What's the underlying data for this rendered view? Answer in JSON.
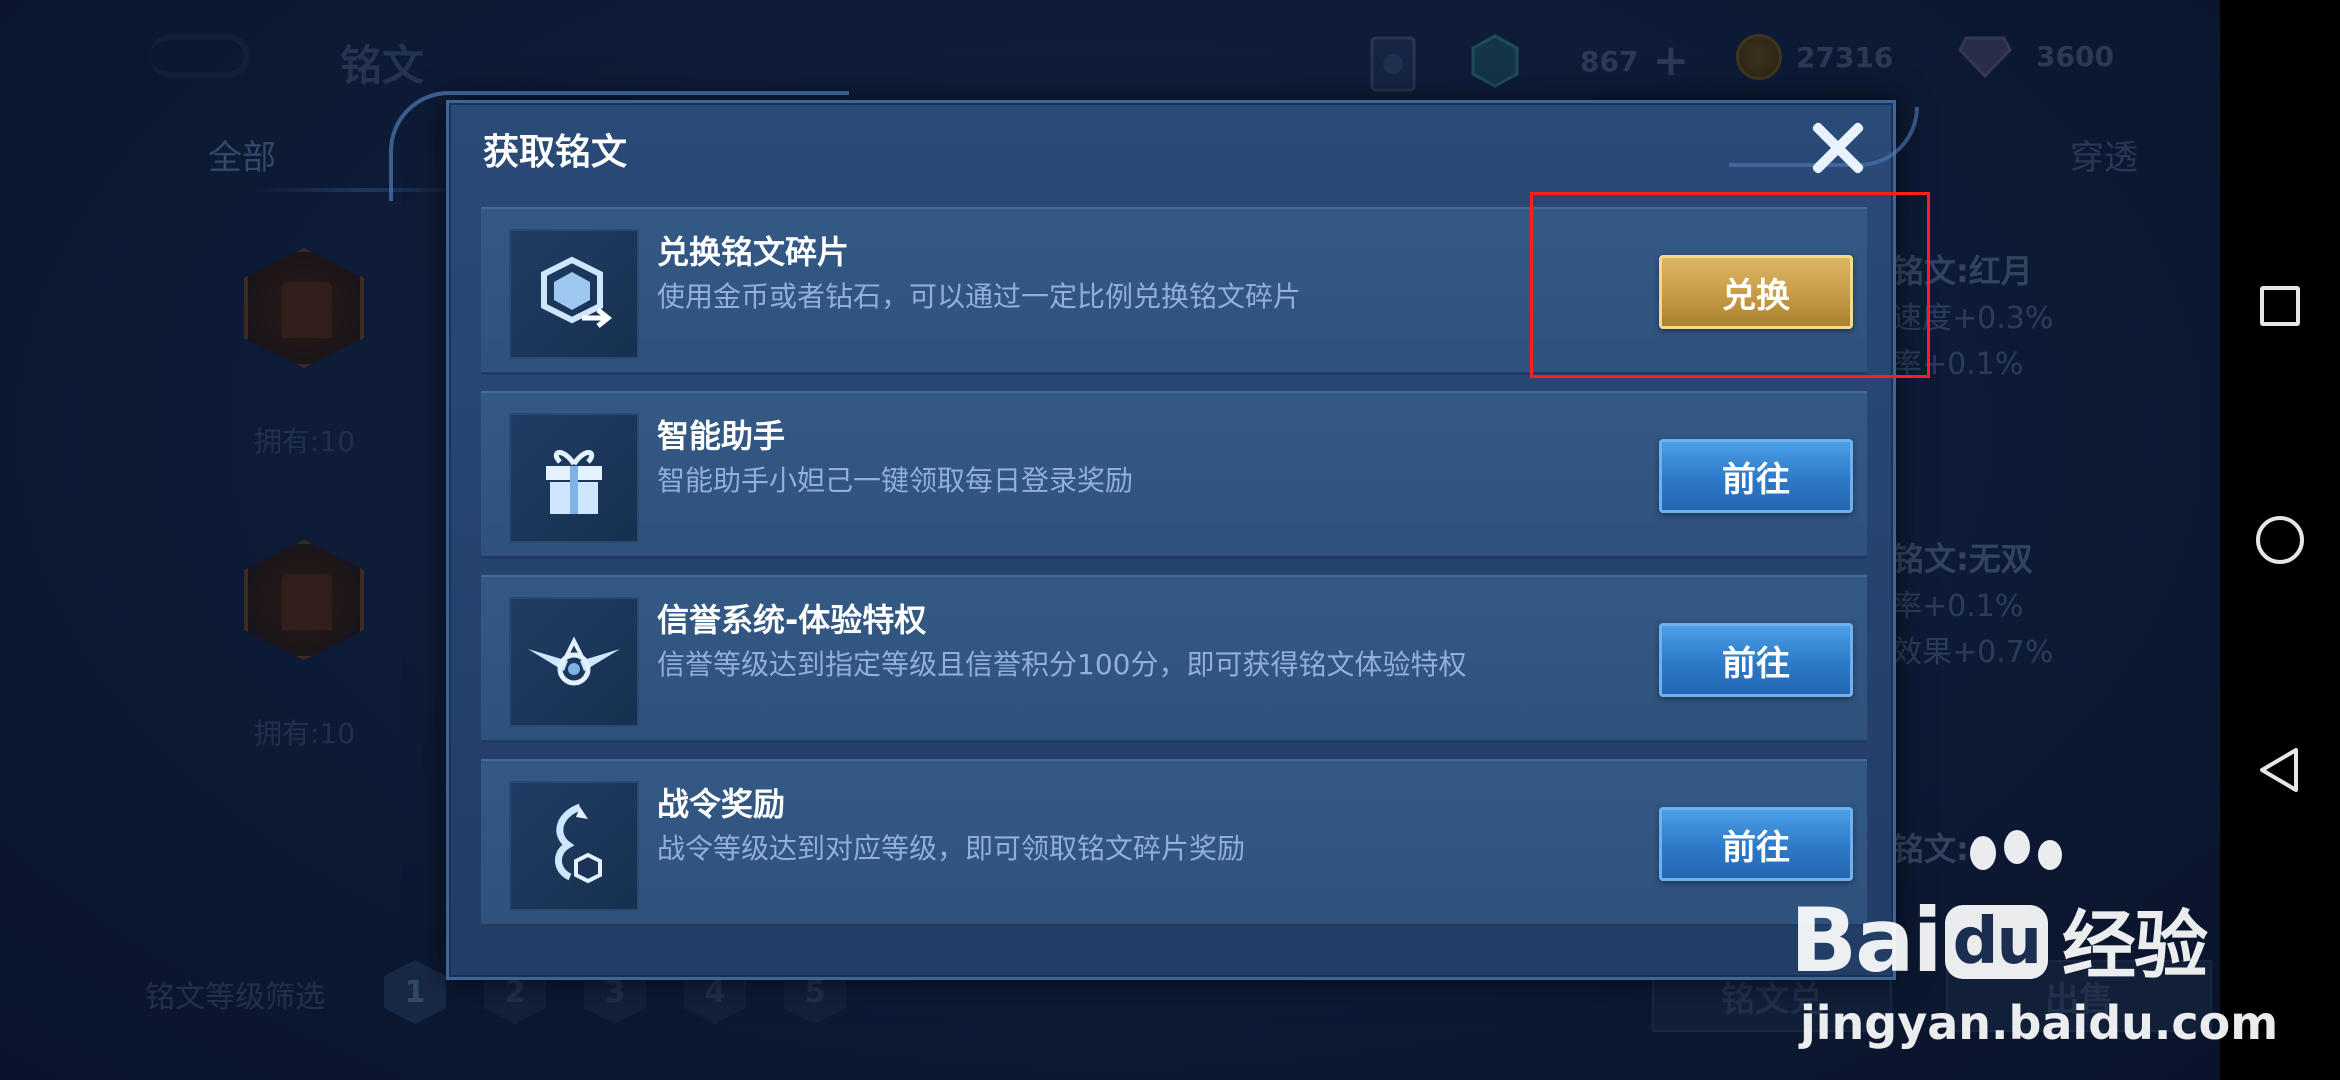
{
  "topbar": {
    "title": "铭文",
    "fragments": "867",
    "gold": "27316",
    "diamonds": "3600"
  },
  "tabs": {
    "all": "全部",
    "penetrate": "穿透"
  },
  "background": {
    "own_1": "拥有:10",
    "own_2": "拥有:10",
    "side_1_title": "铭文:红月",
    "side_1_line1": "速度+0.3%",
    "side_1_line2": "率+0.1%",
    "side_2_title": "铭文:无双",
    "side_2_line1": "率+0.1%",
    "side_2_line2": "效果+0.7%",
    "side_3_title": "铭文:",
    "filter_label": "铭文等级筛选",
    "levels": [
      "1",
      "2",
      "3",
      "4",
      "5"
    ],
    "bottom_btn_1": "铭文兑",
    "bottom_btn_2": "出售"
  },
  "modal": {
    "title": "获取铭文",
    "rows": [
      {
        "title": "兑换铭文碎片",
        "desc": "使用金币或者钻石，可以通过一定比例兑换铭文碎片",
        "button": "兑换",
        "icon": "exchange-icon"
      },
      {
        "title": "智能助手",
        "desc": "智能助手小妲己一键领取每日登录奖励",
        "button": "前往",
        "icon": "gift-icon"
      },
      {
        "title": "信誉系统-体验特权",
        "desc": "信誉等级达到指定等级且信誉积分100分，即可获得铭文体验特权",
        "button": "前往",
        "icon": "credit-wings-icon"
      },
      {
        "title": "战令奖励",
        "desc": "战令等级达到对应等级，即可领取铭文碎片奖励",
        "button": "前往",
        "icon": "battle-pass-icon"
      }
    ]
  },
  "watermark": {
    "logo_pre": "Bai",
    "logo_du": "du",
    "logo_cn": "经验",
    "url": "jingyan.baidu.com"
  },
  "colors": {
    "highlight": "#ff1e1e",
    "gold_button": "#c79b45",
    "blue_button": "#2d7ac9"
  }
}
